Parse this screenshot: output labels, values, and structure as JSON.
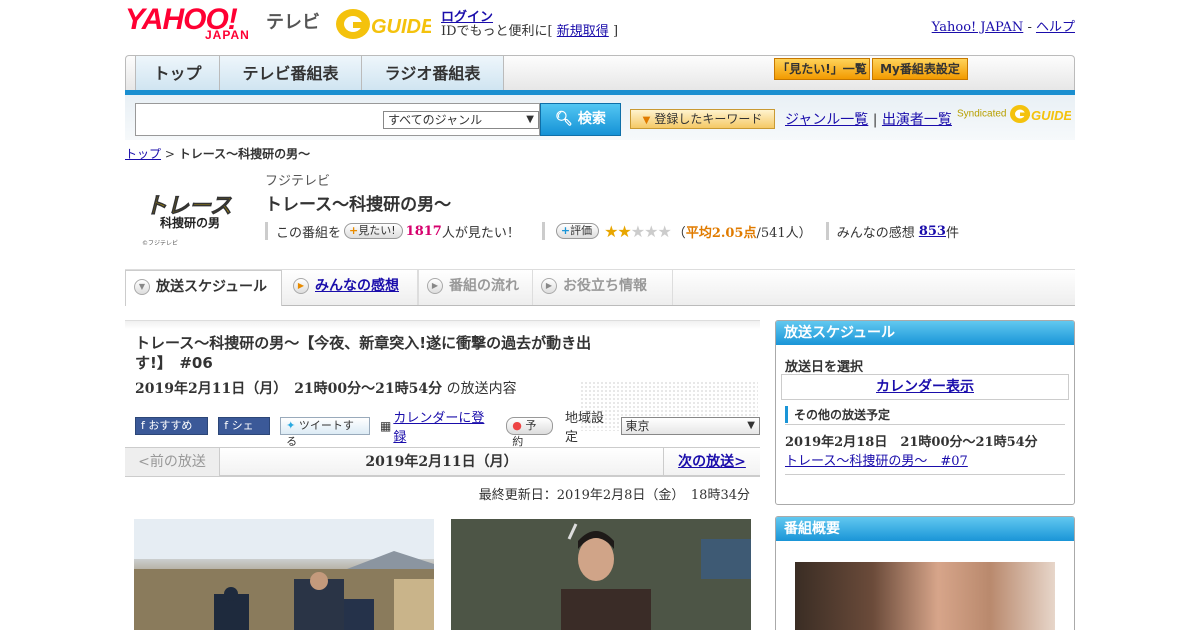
{
  "header": {
    "logo_yahoo": "YAHOO!",
    "logo_japan": "JAPAN",
    "logo_tv": "テレビ",
    "logo_gguide": "G-GUIDE",
    "login_label": "ログイン",
    "login_sub_prefix": "IDでもっと便利に[",
    "signup_label": "新規取得",
    "login_sub_suffix": "]",
    "yahoo_japan_link": "Yahoo! JAPAN",
    "separator": "-",
    "help_link": "ヘルプ"
  },
  "gnav": {
    "tabs": [
      {
        "label": "トップ"
      },
      {
        "label": "テレビ番組表"
      },
      {
        "label": "ラジオ番組表"
      }
    ],
    "mitai_list": "「見たい!」一覧",
    "my_schedule": "My番組表設定"
  },
  "search": {
    "placeholder": "",
    "genre_selected": "すべてのジャンル",
    "button_label": "検索",
    "keyword_button": "登録したキーワード",
    "genre_list_link": "ジャンル一覧",
    "link_separator": "|",
    "performer_list_link": "出演者一覧",
    "syndicated_label": "Syndicated"
  },
  "breadcrumb": {
    "top": "トップ",
    "sep": ">",
    "current": "トレース～科捜研の男～"
  },
  "program": {
    "thumb_title_top": "トレース",
    "thumb_title_bottom": "科捜研の男",
    "thumb_credit": "©フジテレビ",
    "channel": "フジテレビ",
    "title": "トレース～科捜研の男～",
    "mitai_prefix": "この番組を",
    "mitai_button": "見たい!",
    "mitai_count": "1817",
    "mitai_suffix": "人が見たい！",
    "rate_button": "評価",
    "rating_stars": 2,
    "rating_open": "（",
    "rating_avg_label": "平均2.05点",
    "rating_count_text": "/541人）",
    "reviews_prefix": "みんなの感想",
    "reviews_count": "853",
    "reviews_suffix": "件"
  },
  "subtabs": {
    "schedule": "放送スケジュール",
    "kansou": "みんなの感想",
    "nagare": "番組の流れ",
    "info": "お役立ち情報"
  },
  "episode": {
    "title": "トレース～科捜研の男～【今夜、新章突入!遂に衝撃の過去が動き出す!】　#06",
    "date_time": "2019年2月11日（月）　21時00分～21時54分",
    "date_suffix": "の放送内容",
    "fb_recommend": "おすすめ 1",
    "fb_share": "シェア",
    "tweet": "ツイートする",
    "calendar_register": "カレンダーに登録",
    "reserve": "予約",
    "region_label": "地域設定",
    "region_selected": "東京",
    "prev": "<前の放送",
    "current_date": "2019年2月11日（月）",
    "next": "次の放送>",
    "updated": "最終更新日：2019年2月8日（金）　18時34分"
  },
  "sidebar": {
    "schedule_head": "放送スケジュール",
    "select_date": "放送日を選択",
    "calendar_button": "カレンダー表示",
    "other_head": "その他の放送予定",
    "other_date": "2019年2月18日　21時00分～21時54分",
    "other_link": "トレース～科捜研の男～　#07",
    "summary_head": "番組概要"
  },
  "colors": {
    "yahoo_red": "#ff0033",
    "accent_blue": "#1b8fd0",
    "pink_count": "#d6006d",
    "star_gold": "#e8a600"
  }
}
